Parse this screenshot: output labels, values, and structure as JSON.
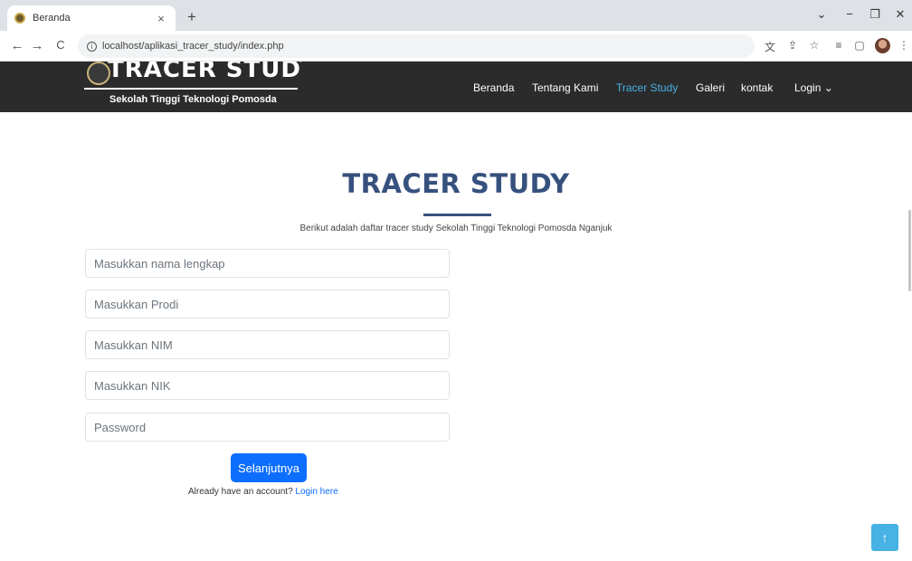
{
  "browser": {
    "tab_title": "Beranda",
    "tab_close": "×",
    "new_tab": "+",
    "url": "localhost/aplikasi_tracer_study/index.php",
    "window_controls": {
      "dropdown": "⌄",
      "minimize": "−",
      "restore": "❐",
      "close": "✕"
    },
    "nav": {
      "back": "←",
      "forward": "→",
      "reload": "C"
    },
    "toolbar_icons": [
      "translate-icon",
      "share-icon",
      "star-icon",
      "reading-list-icon",
      "sidebar-icon",
      "profile-avatar",
      "menu-icon"
    ]
  },
  "site": {
    "brand_title": "TRACER STUDY",
    "brand_subtitle": "Sekolah Tinggi Teknologi Pomosda",
    "nav": [
      "Beranda",
      "Tentang Kami",
      "Tracer Study",
      "Galeri",
      "kontak",
      "Login ⌄"
    ],
    "active_nav": "Tracer Study",
    "accent_color": "#47b2e4",
    "navbar_color": "#2b2b2b"
  },
  "main": {
    "heading": "TRACER STUDY",
    "description": "Berikut adalah daftar tracer study Sekolah Tinggi Teknologi Pomosda Nganjuk",
    "fields": {
      "nama": "Masukkan nama lengkap",
      "prodi": "Masukkan Prodi",
      "nim": "Masukkan NIM",
      "nik": "Masukkan NIK",
      "password": "Password"
    },
    "submit_label": "Selanjutnya",
    "login_prompt": "Already have an account?",
    "login_link": "Login here",
    "primary_color": "#0d6efd"
  },
  "scroll_top_icon": "↑"
}
